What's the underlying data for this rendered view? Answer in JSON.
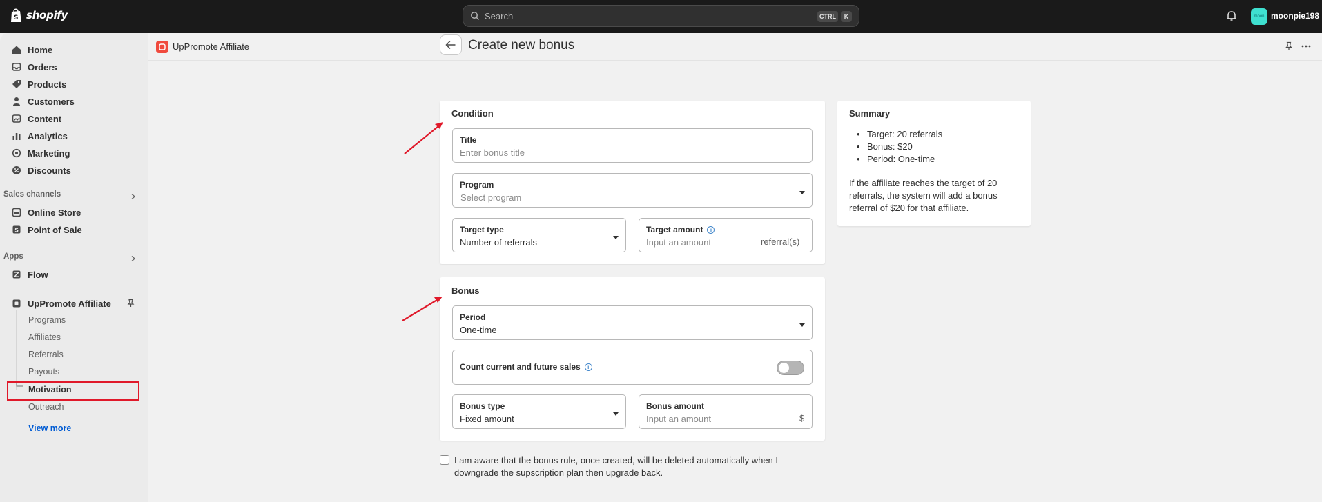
{
  "topbar": {
    "logo_text": "shopify",
    "search_placeholder": "Search",
    "kbd_ctrl": "CTRL",
    "kbd_k": "K",
    "avatar_text": "moon",
    "username": "moonpie198"
  },
  "sidebar": {
    "items": [
      {
        "label": "Home",
        "icon": "home-icon"
      },
      {
        "label": "Orders",
        "icon": "inbox-icon"
      },
      {
        "label": "Products",
        "icon": "tag-icon"
      },
      {
        "label": "Customers",
        "icon": "person-icon"
      },
      {
        "label": "Content",
        "icon": "image-icon"
      },
      {
        "label": "Analytics",
        "icon": "bar-chart-icon"
      },
      {
        "label": "Marketing",
        "icon": "target-icon"
      },
      {
        "label": "Discounts",
        "icon": "discount-icon"
      }
    ],
    "sales_channels_heading": "Sales channels",
    "channels": [
      {
        "label": "Online Store",
        "icon": "store-icon"
      },
      {
        "label": "Point of Sale",
        "icon": "pos-icon"
      }
    ],
    "apps_heading": "Apps",
    "apps": [
      {
        "label": "Flow",
        "icon": "flow-icon"
      },
      {
        "label": "UpPromote Affiliate",
        "icon": "app-icon"
      }
    ],
    "subitems": [
      "Programs",
      "Affiliates",
      "Referrals",
      "Payouts",
      "Motivation",
      "Outreach"
    ],
    "view_more": "View more"
  },
  "appbar": {
    "title": "UpPromote Affiliate"
  },
  "page": {
    "title": "Create new bonus"
  },
  "condition": {
    "heading": "Condition",
    "title_label": "Title",
    "title_placeholder": "Enter bonus title",
    "program_label": "Program",
    "program_placeholder": "Select program",
    "target_type_label": "Target type",
    "target_type_value": "Number of referrals",
    "target_amount_label": "Target amount",
    "target_amount_placeholder": "Input an amount",
    "target_amount_suffix": "referral(s)"
  },
  "bonus": {
    "heading": "Bonus",
    "period_label": "Period",
    "period_value": "One-time",
    "count_label": "Count current and future sales",
    "count_enabled": false,
    "bonus_type_label": "Bonus type",
    "bonus_type_value": "Fixed amount",
    "bonus_amount_label": "Bonus amount",
    "bonus_amount_placeholder": "Input an amount",
    "bonus_amount_suffix": "$"
  },
  "summary": {
    "heading": "Summary",
    "items": [
      "Target: 20 referrals",
      "Bonus: $20",
      "Period: One-time"
    ],
    "text": "If the affiliate reaches the target of 20 referrals, the system will add a bonus referral of $20 for that affiliate."
  },
  "agreement": {
    "text": "I am aware that the bonus rule, once created, will be deleted automatically when I downgrade the supscription plan then upgrade back.",
    "checked": false
  },
  "colors": {
    "topbar": "#1a1a1a",
    "annotation": "#e0192a",
    "link": "#005bd3",
    "app_logo": "#f04a3d"
  }
}
